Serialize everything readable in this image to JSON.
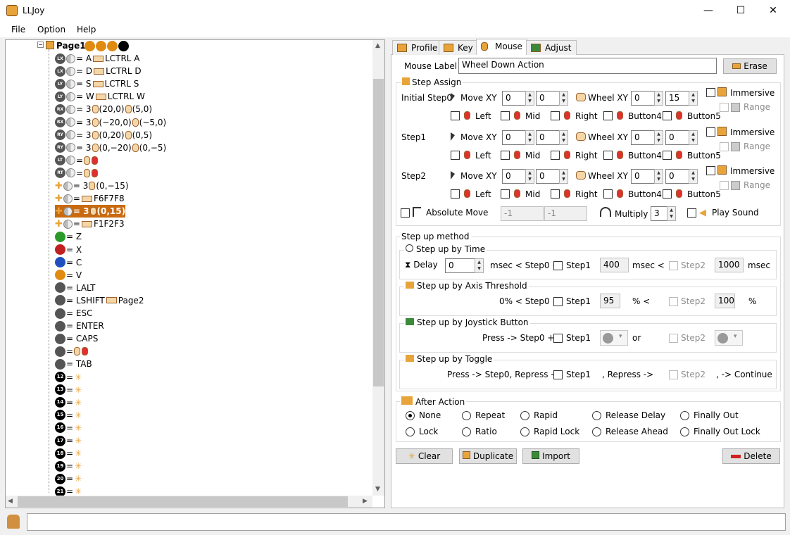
{
  "window": {
    "title": "LLJoy",
    "minimize": "—",
    "maximize": "☐",
    "close": "✕"
  },
  "menu": {
    "file": "File",
    "option": "Option",
    "help": "Help"
  },
  "tree": {
    "root": "Page1",
    "rows": [
      {
        "badge": "LX",
        "rest": "= A",
        "extra": "LCTRL A"
      },
      {
        "badge": "LX",
        "rest": "= D",
        "extra": "LCTRL D"
      },
      {
        "badge": "LY",
        "rest": "= S",
        "extra": "LCTRL S"
      },
      {
        "badge": "LY",
        "rest": "= W",
        "extra": "LCTRL W"
      },
      {
        "badge": "RX",
        "rest": "= 3",
        "extra": "(20,0)",
        "extra2": "(5,0)"
      },
      {
        "badge": "RX",
        "rest": "= 3",
        "extra": "(−20,0)",
        "extra2": "(−5,0)"
      },
      {
        "badge": "RY",
        "rest": "= 3",
        "extra": "(0,20)",
        "extra2": "(0,5)"
      },
      {
        "badge": "RY",
        "rest": "= 3",
        "extra": "(0,−20)",
        "extra2": "(0,−5)"
      },
      {
        "badge": "LT",
        "rest": "=",
        "extra": ""
      },
      {
        "badge": "RT",
        "rest": "=",
        "extra": ""
      },
      {
        "badge": "+",
        "rest": "= 3",
        "extra": "(0,−15)"
      },
      {
        "badge": "+",
        "rest": "=",
        "extra": "F6",
        "extra2": "F7",
        "extra3": "F8"
      },
      {
        "badge": "+",
        "rest": "= 3",
        "extra": "(0,15)"
      },
      {
        "badge": "+",
        "rest": "=",
        "extra": "F1",
        "extra2": "F2",
        "extra3": "F3"
      },
      {
        "badge": "",
        "rest": "= Z",
        "extra": ""
      },
      {
        "badge": "",
        "rest": "= X",
        "extra": ""
      },
      {
        "badge": "",
        "rest": "= C",
        "extra": ""
      },
      {
        "badge": "",
        "rest": "= V",
        "extra": ""
      },
      {
        "badge": "",
        "rest": "= LALT",
        "extra": ""
      },
      {
        "badge": "",
        "rest": "= LSHIFT",
        "extra": "Page2"
      },
      {
        "badge": "",
        "rest": "= ESC",
        "extra": ""
      },
      {
        "badge": "",
        "rest": "= ENTER",
        "extra": ""
      },
      {
        "badge": "",
        "rest": "= CAPS",
        "extra": ""
      },
      {
        "badge": "",
        "rest": "=",
        "extra": ""
      },
      {
        "badge": "",
        "rest": "= TAB",
        "extra": ""
      },
      {
        "badge": "12",
        "rest": "=",
        "extra": ""
      },
      {
        "badge": "13",
        "rest": "=",
        "extra": ""
      },
      {
        "badge": "14",
        "rest": "=",
        "extra": ""
      },
      {
        "badge": "15",
        "rest": "=",
        "extra": ""
      },
      {
        "badge": "16",
        "rest": "=",
        "extra": ""
      },
      {
        "badge": "17",
        "rest": "=",
        "extra": ""
      },
      {
        "badge": "18",
        "rest": "=",
        "extra": ""
      },
      {
        "badge": "19",
        "rest": "=",
        "extra": ""
      },
      {
        "badge": "20",
        "rest": "=",
        "extra": ""
      },
      {
        "badge": "21",
        "rest": "=",
        "extra": ""
      }
    ]
  },
  "tabs": {
    "profile": "Profile",
    "key": "Key",
    "mouse": "Mouse",
    "adjust": "Adjust"
  },
  "mouse_label": {
    "label": "Mouse Label",
    "value": "Wheel Down Action",
    "erase": "Erase"
  },
  "step_assign": {
    "title": "Step Assign",
    "move_xy": "Move XY",
    "wheel_xy": "Wheel XY",
    "immersive": "Immersive",
    "range": "Range",
    "left": "Left",
    "mid": "Mid",
    "right": "Right",
    "button4": "Button4",
    "button5": "Button5",
    "steps": [
      {
        "name": "Initial Step0",
        "mx": "0",
        "my": "0",
        "wx": "0",
        "wy": "15"
      },
      {
        "name": "Step1",
        "mx": "0",
        "my": "0",
        "wx": "0",
        "wy": "0"
      },
      {
        "name": "Step2",
        "mx": "0",
        "my": "0",
        "wx": "0",
        "wy": "0"
      }
    ],
    "absolute_move": "Absolute Move",
    "abs_x": "-1",
    "abs_y": "-1",
    "multiply": "Multiply",
    "multiply_value": "3",
    "play_sound": "Play Sound"
  },
  "step_up": {
    "title": "Step up method",
    "time": {
      "title": "Step up by Time",
      "delay": "Delay",
      "delay_value": "0",
      "msec_step0": "msec < Step0 <",
      "step1": "Step1",
      "v1": "400",
      "msec_lt": "msec <",
      "step2": "Step2",
      "v2": "1000",
      "msec": "msec"
    },
    "axis": {
      "title": "Step up by Axis Threshold",
      "text": "0% < Step0 <",
      "step1": "Step1",
      "v1": "95",
      "pct_lt": "% <",
      "step2": "Step2",
      "v2": "100",
      "pct": "%"
    },
    "joy": {
      "title": "Step up by Joystick Button",
      "text": "Press -> Step0 +",
      "step1": "Step1",
      "or": "or",
      "step2": "Step2"
    },
    "toggle": {
      "title": "Step up by Toggle",
      "text": "Press -> Step0, Repress ->",
      "step1": "Step1",
      "repress": ", Repress ->",
      "step2": "Step2",
      "cont": ", -> Continue"
    }
  },
  "after_action": {
    "title": "After Action",
    "options": [
      "None",
      "Repeat",
      "Rapid",
      "Release Delay",
      "Finally Out",
      "Lock",
      "Ratio",
      "Rapid Lock",
      "Release Ahead",
      "Finally Out Lock"
    ],
    "selected": "None"
  },
  "buttons": {
    "clear": "Clear",
    "duplicate": "Duplicate",
    "import": "Import",
    "delete": "Delete"
  },
  "colors": {
    "accent": "#e8a43a",
    "selection": "#c96a10"
  }
}
